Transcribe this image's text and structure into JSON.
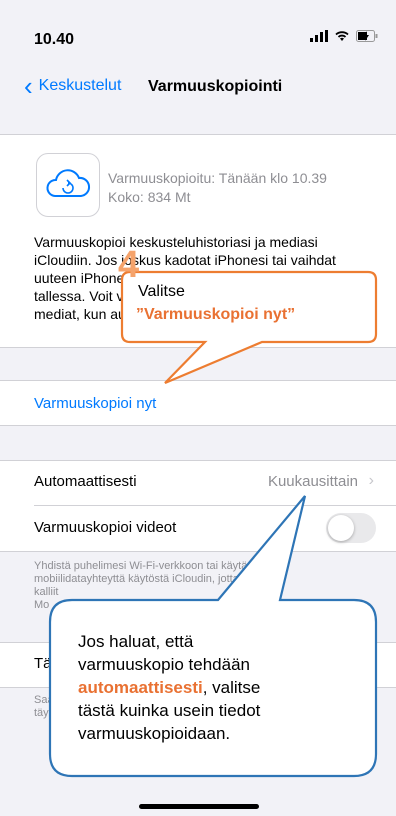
{
  "status": {
    "time": "10.40"
  },
  "nav": {
    "back_label": "Keskustelut",
    "title": "Varmuuskopiointi"
  },
  "backup_info": {
    "last_backup": "Varmuuskopioitu: Tänään klo 10.39",
    "size": "Koko: 834 Mt",
    "description_lines": [
      "Varmuuskopioi keskusteluhistoriasi ja mediasi",
      "iCloudiin. Jos joskus kadotat iPhonesi tai vaihdat",
      "uuteen iPhoneen, keskusteluhistoriasi pysyy",
      "tallessa. Voit valita, varmuuskopioidaanko",
      "mediat, kun automaattinen varmuuskopio tehdään."
    ]
  },
  "backup_now": {
    "label": "Varmuuskopioi nyt"
  },
  "auto_backup": {
    "label": "Automaattisesti",
    "value": "Kuukausittain"
  },
  "videos": {
    "label": "Varmuuskopioi videot",
    "enabled": false
  },
  "footer_lines": [
    "Yhdistä puhelimesi Wi-Fi-verkkoon tai käytä",
    "mobiilidatayhteyttä käytöstä iCloudin, jotta välttäisi",
    "kalliit",
    "Mo"
  ],
  "row2": {
    "label": "Tä"
  },
  "footer2_lines": [
    "Saa",
    "täy"
  ],
  "callout1": {
    "step": "4",
    "line1": "Valitse",
    "line2": "”Varmuuskopioi nyt”"
  },
  "callout2": {
    "line1": "Jos haluat, että",
    "line2": "varmuuskopio tehdään",
    "highlight": "automaattisesti",
    "line3_tail": ", valitse",
    "line4": "tästä kuinka usein tiedot",
    "line5": "varmuuskopioidaan."
  },
  "colors": {
    "accent": "#007aff",
    "callout_border": "#ed7d31",
    "callout2_border": "#2e75b6",
    "highlight": "#e97132"
  }
}
